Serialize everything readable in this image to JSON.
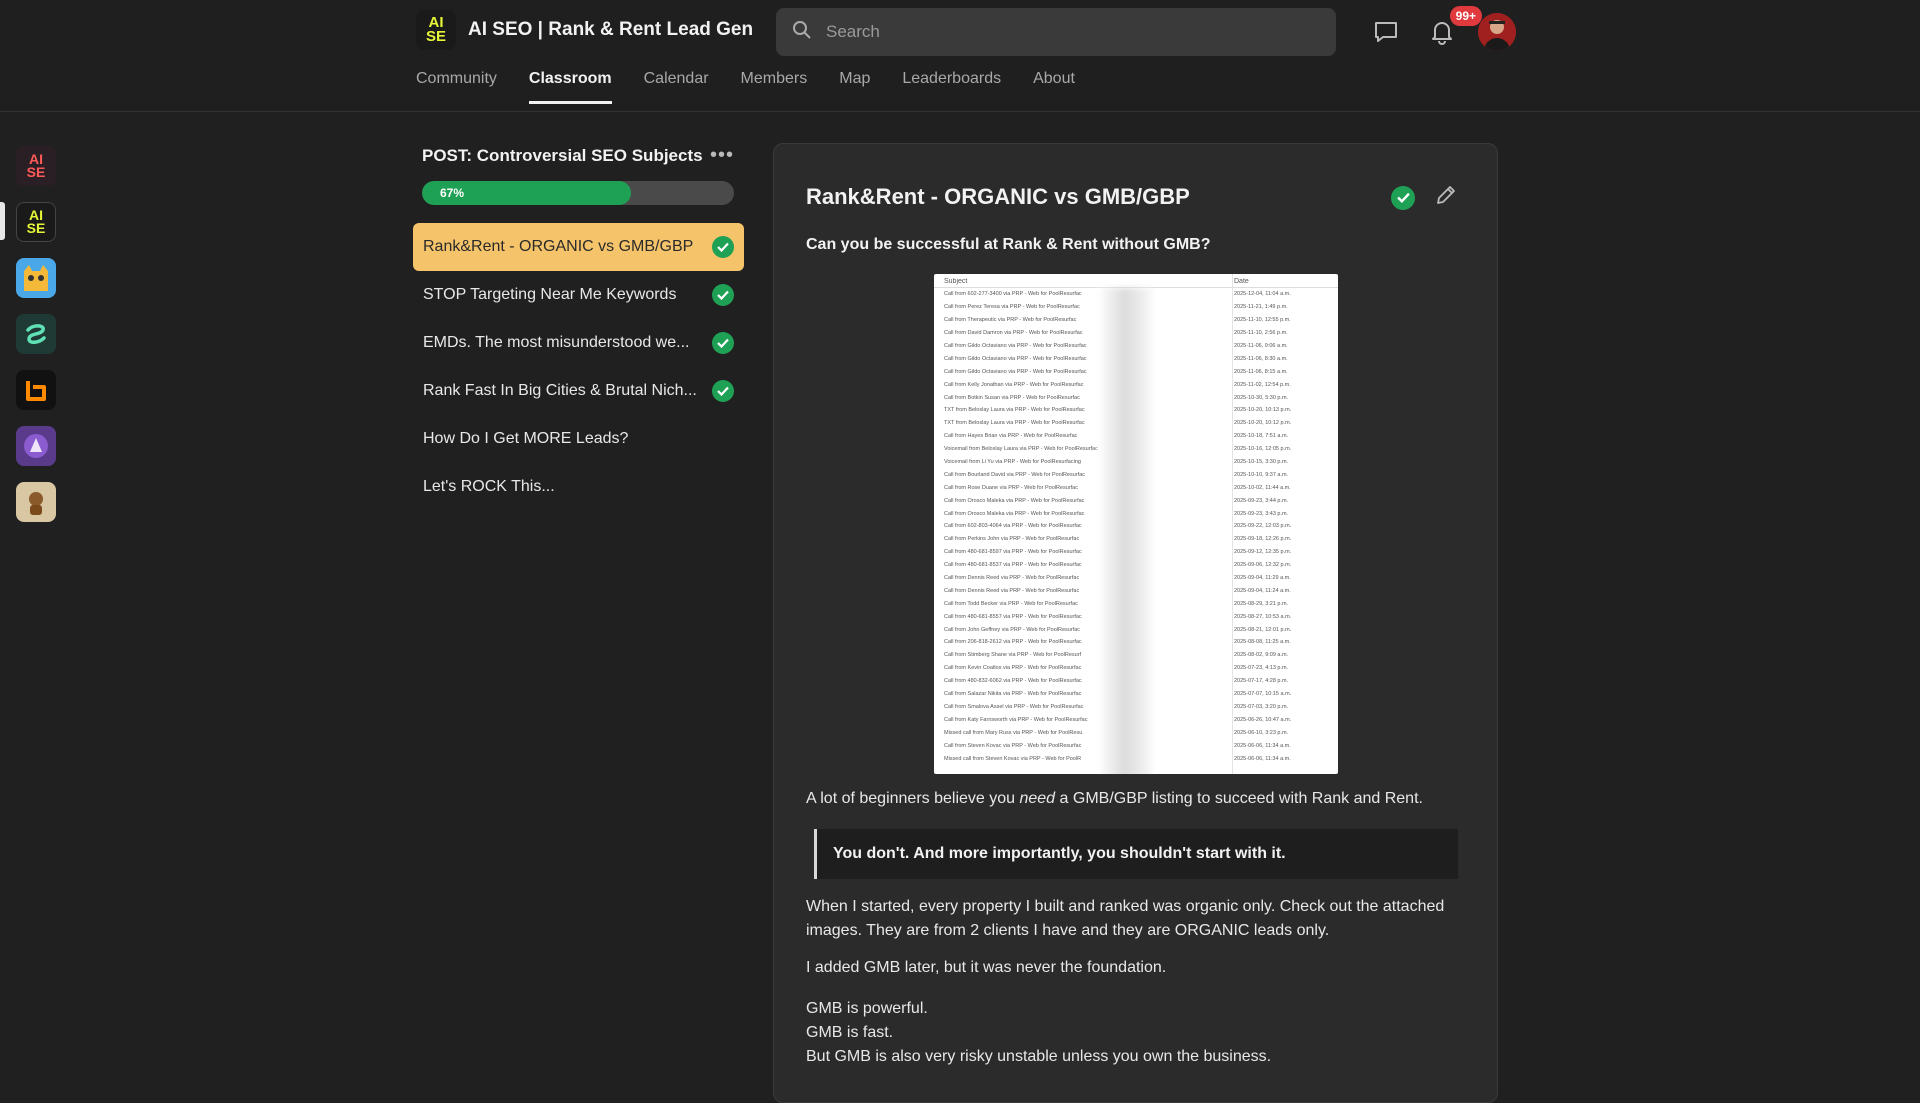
{
  "header": {
    "brand_logo_top": "AI",
    "brand_logo_bottom": "SE",
    "title": "AI SEO | Rank & Rent Lead Gen",
    "search_placeholder": "Search",
    "notifications_badge": "99+"
  },
  "tabs": [
    {
      "label": "Community",
      "active": false
    },
    {
      "label": "Classroom",
      "active": true
    },
    {
      "label": "Calendar",
      "active": false
    },
    {
      "label": "Members",
      "active": false
    },
    {
      "label": "Map",
      "active": false
    },
    {
      "label": "Leaderboards",
      "active": false
    },
    {
      "label": "About",
      "active": false
    }
  ],
  "rail": {
    "items": [
      {
        "label_top": "AI",
        "label_bottom": "SE",
        "bg": "#2a1f24",
        "fg": "#ff5a5a"
      },
      {
        "label_top": "AI",
        "label_bottom": "SE",
        "bg": "#1a1a1a",
        "fg": "#e5f537"
      },
      {
        "label_top": "",
        "label_bottom": "",
        "bg": "#f5b93a",
        "fg": "#333"
      },
      {
        "label_top": "",
        "label_bottom": "",
        "bg": "#1f3a34",
        "fg": "#5fe0b5"
      },
      {
        "label_top": "",
        "label_bottom": "",
        "bg": "#111111",
        "fg": "#ff8a00"
      },
      {
        "label_top": "",
        "label_bottom": "",
        "bg": "#5a3a8a",
        "fg": "#fff"
      },
      {
        "label_top": "",
        "label_bottom": "",
        "bg": "#d9c7a4",
        "fg": "#7a4a1a"
      }
    ]
  },
  "course": {
    "title": "POST: Controversial SEO Subjects",
    "progress_label": "67%",
    "progress": 0.67,
    "lessons": [
      {
        "label": "Rank&Rent - ORGANIC vs GMB/GBP",
        "done": true,
        "active": true
      },
      {
        "label": "STOP Targeting Near Me Keywords",
        "done": true,
        "active": false
      },
      {
        "label": "EMDs. The most misunderstood we...",
        "done": true,
        "active": false
      },
      {
        "label": "Rank Fast In Big Cities & Brutal Nich...",
        "done": true,
        "active": false
      },
      {
        "label": "How Do I Get MORE Leads?",
        "done": false,
        "active": false
      },
      {
        "label": "Let's ROCK This...",
        "done": false,
        "active": false
      }
    ]
  },
  "lesson": {
    "title": "Rank&Rent - ORGANIC vs GMB/GBP",
    "question": "Can you be successful at Rank & Rent without GMB?",
    "p1_before": "A lot of beginners believe you ",
    "p1_em": "need",
    "p1_after": " a GMB/GBP listing to succeed with Rank and Rent.",
    "quote": "You don't. And more importantly, you shouldn't start with it.",
    "p2": "When I started, every property I built and ranked was organic only. Check out the attached images. They are from 2 clients I have and they are ORGANIC leads only.",
    "p3": "I added GMB later, but it was never the foundation.",
    "p4_l1": "GMB is powerful.",
    "p4_l2": "GMB is fast.",
    "p4_l3": "But GMB is also very risky unstable unless you own the business."
  },
  "screenshot": {
    "header_subject": "Subject",
    "header_date": "Date",
    "rows": [
      {
        "subject": "Call from 602-277-3400 via PRP - Web for PoolResurfac",
        "date": "2025-12-04, 11:04 a.m."
      },
      {
        "subject": "Call from Perez Teresa via PRP - Web for PoolResurfac",
        "date": "2025-11-21, 1:49 p.m."
      },
      {
        "subject": "Call from Therapeutic via PRP - Web for PoolResurfac",
        "date": "2025-11-10, 12:55 p.m."
      },
      {
        "subject": "Call from David Damron via PRP - Web for PoolResurfac",
        "date": "2025-11-10, 2:56 p.m."
      },
      {
        "subject": "Call from Gildo Octaviano via PRP - Web for PoolResurfac",
        "date": "2025-11-06, 9:06 a.m."
      },
      {
        "subject": "Call from Gildo Octaviano via PRP - Web for PoolResurfac",
        "date": "2025-11-06, 8:30 a.m."
      },
      {
        "subject": "Call from Gildo Octaviano via PRP - Web for PoolResurfac",
        "date": "2025-11-06, 8:15 a.m."
      },
      {
        "subject": "Call from Kelly Jonathan via PRP - Web for PoolResurfac",
        "date": "2025-11-02, 12:54 p.m."
      },
      {
        "subject": "Call from Botkin Susan via PRP - Web for PoolResurfac",
        "date": "2025-10-30, 5:30 p.m."
      },
      {
        "subject": "TXT from Beloslay Laura via PRP - Web for PoolResurfac",
        "date": "2025-10-20, 10:13 p.m."
      },
      {
        "subject": "TXT from Beloslay Laura via PRP - Web for PoolResurfac",
        "date": "2025-10-20, 10:12 p.m."
      },
      {
        "subject": "Call from Hayes Brian via PRP - Web for PoolResurfac",
        "date": "2025-10-18, 7:51 a.m."
      },
      {
        "subject": "Voicemail from Beloslay Laura via PRP - Web for PoolResurfac",
        "date": "2025-10-16, 12:05 p.m."
      },
      {
        "subject": "Voicemail from Li Yu via PRP - Web for PoolResurfacing",
        "date": "2025-10-15, 3:30 p.m."
      },
      {
        "subject": "Call from Bourland David via PRP - Web for PoolResurfac",
        "date": "2025-10-10, 9:37 a.m."
      },
      {
        "subject": "Call from Rose Duane via PRP - Web for PoolResurfac",
        "date": "2025-10-02, 11:44 a.m."
      },
      {
        "subject": "Call from Orosco Maleka via PRP - Web for PoolResurfac",
        "date": "2025-09-23, 3:44 p.m."
      },
      {
        "subject": "Call from Orosco Maleka via PRP - Web for PoolResurfac",
        "date": "2025-09-23, 3:43 p.m."
      },
      {
        "subject": "Call from 602-803-4064 via PRP - Web for PoolResurfac",
        "date": "2025-09-22, 12:03 p.m."
      },
      {
        "subject": "Call from Perkins John via PRP - Web for PoolResurfac",
        "date": "2025-09-18, 12:26 p.m."
      },
      {
        "subject": "Call from 480-681-8597 via PRP - Web for PoolResurfac",
        "date": "2025-09-12, 12:35 p.m."
      },
      {
        "subject": "Call from 480-681-8537 via PRP - Web for PoolResurfac",
        "date": "2025-09-06, 12:32 p.m."
      },
      {
        "subject": "Call from Dennis Reed via PRP - Web for PoolResurfac",
        "date": "2025-09-04, 11:29 a.m."
      },
      {
        "subject": "Call from Dennis Reed via PRP - Web for PoolResurfac",
        "date": "2025-09-04, 11:24 a.m."
      },
      {
        "subject": "Call from Todd Becker via PRP - Web for PoolResurfac",
        "date": "2025-08-29, 3:21 p.m."
      },
      {
        "subject": "Call from 480-681-8557 via PRP - Web for PoolResurfac",
        "date": "2025-08-27, 10:53 a.m."
      },
      {
        "subject": "Call from John Geffney via PRP - Web for PoolResurfac",
        "date": "2025-08-21, 12:01 p.m."
      },
      {
        "subject": "Call from 206-818-2612 via PRP - Web for PoolResurfac",
        "date": "2025-08-08, 11:25 a.m."
      },
      {
        "subject": "Call from Stimberg Shane via PRP - Web for PoolResurf",
        "date": "2025-08-02, 9:09 a.m."
      },
      {
        "subject": "Call from Kevin Coatlos via PRP - Web for PoolResurfac",
        "date": "2025-07-23, 4:13 p.m."
      },
      {
        "subject": "Call from 480-832-6062 via PRP - Web for PoolResurfac",
        "date": "2025-07-17, 4:28 p.m."
      },
      {
        "subject": "Call from Salazar Nikita via PRP - Web for PoolResurfac",
        "date": "2025-07-07, 10:15 a.m."
      },
      {
        "subject": "Call from Smalova Assel via PRP - Web for PoolResurfac",
        "date": "2025-07-03, 3:20 p.m."
      },
      {
        "subject": "Call from Katy Farnsworth via PRP - Web for PoolResurfac",
        "date": "2025-06-26, 10:47 a.m."
      },
      {
        "subject": "Missed call from Mary Russ via PRP - Web for PoolResu",
        "date": "2025-06-10, 3:23 p.m."
      },
      {
        "subject": "Call from Steven Kovac via PRP - Web for PoolResurfac",
        "date": "2025-06-06, 11:34 a.m."
      },
      {
        "subject": "Missed call from Steven Kovac via PRP - Web for PoolR",
        "date": "2025-06-06, 11:34 a.m."
      }
    ]
  }
}
